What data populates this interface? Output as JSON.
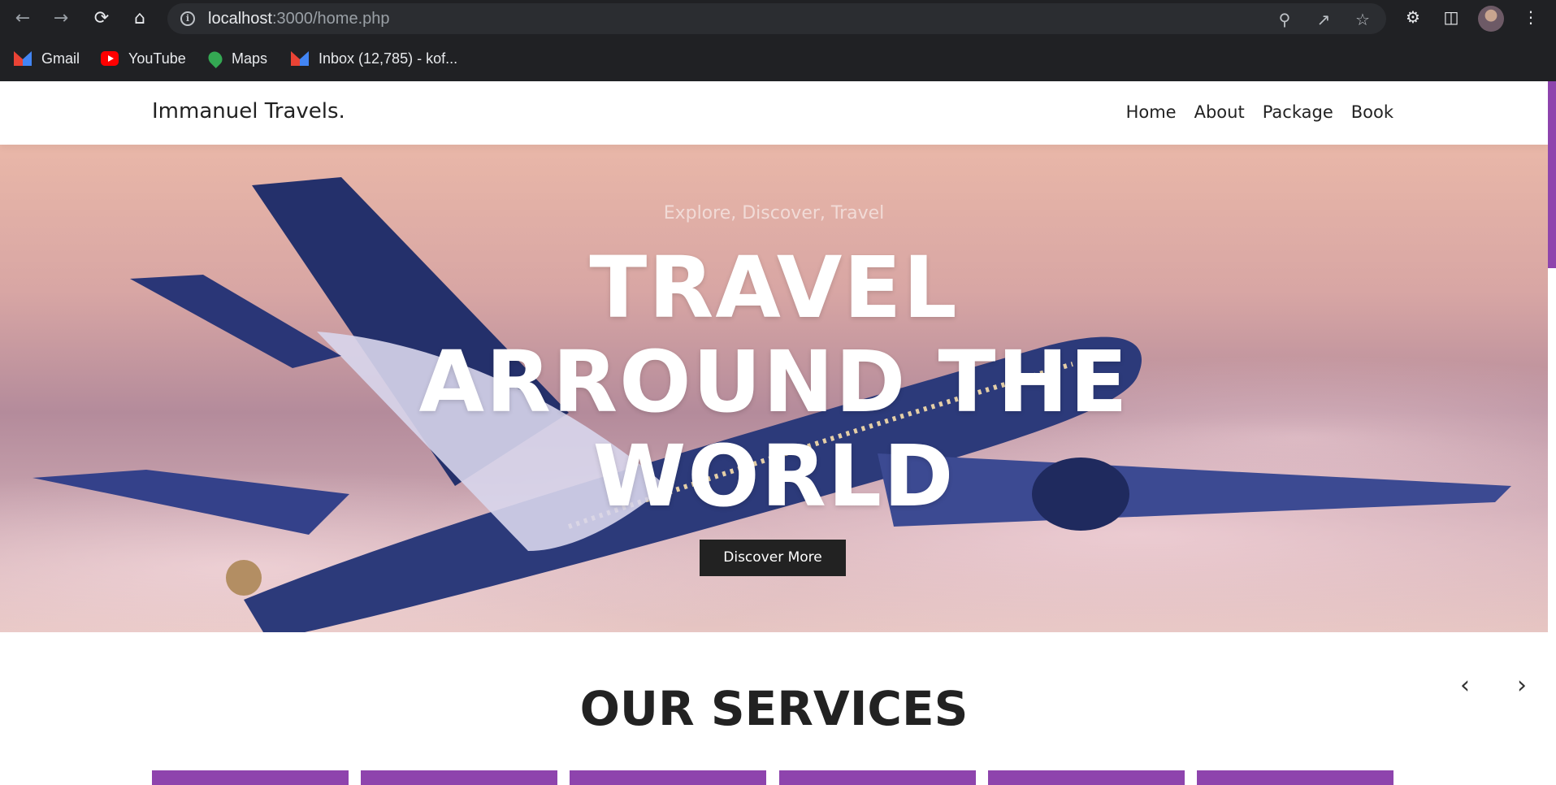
{
  "browser": {
    "url_host": "localhost",
    "url_path": ":3000/home.php",
    "icons": [
      "back-icon",
      "forward-icon",
      "reload-icon",
      "home-icon",
      "info-icon",
      "zoom-icon",
      "share-icon",
      "star-icon",
      "extensions-icon",
      "side-panel-icon",
      "profile-avatar",
      "menu-icon"
    ]
  },
  "bookmarks": [
    {
      "label": "Gmail",
      "icon": "gmail-icon"
    },
    {
      "label": "YouTube",
      "icon": "youtube-icon"
    },
    {
      "label": "Maps",
      "icon": "maps-icon"
    },
    {
      "label": "Inbox (12,785) - kof...",
      "icon": "gmail-icon"
    }
  ],
  "site": {
    "logo": "Immanuel Travels.",
    "nav": [
      "Home",
      "About",
      "Package",
      "Book"
    ]
  },
  "hero": {
    "subtitle": "Explore, Discover, Travel",
    "headline_lines": [
      "TRAVEL",
      "ARROUND THE",
      "WORLD"
    ],
    "cta": "Discover More"
  },
  "services": {
    "title": "OUR SERVICES"
  },
  "colors": {
    "accent": "#8e44ad",
    "button_bg": "#222222",
    "chrome_bg": "#202124"
  }
}
